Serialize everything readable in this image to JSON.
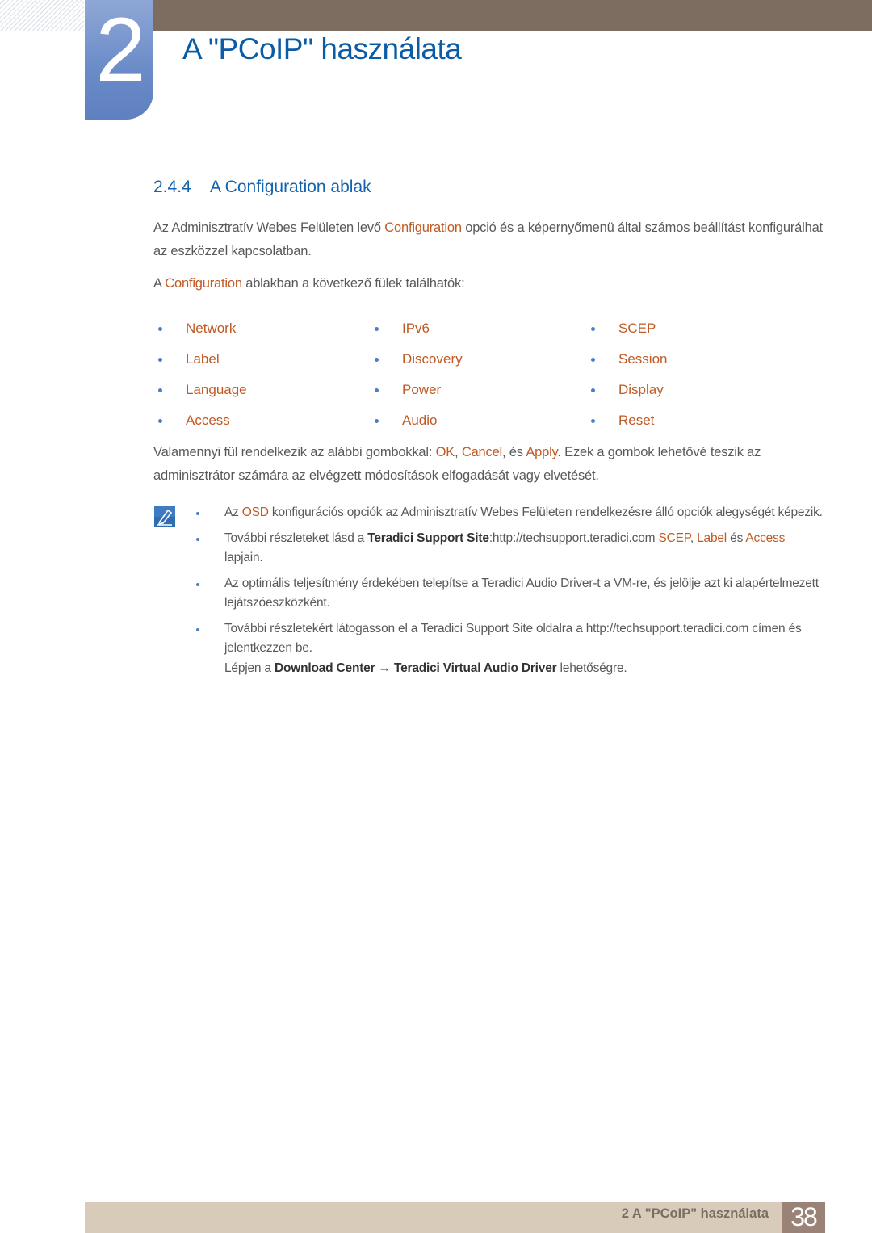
{
  "header": {
    "chapter_number": "2",
    "chapter_title": "A \"PCoIP\" használata"
  },
  "section": {
    "number": "2.4.4",
    "title": "A Configuration ablak"
  },
  "intro": {
    "p1_a": "Az Adminisztratív Webes Felületen levő ",
    "p1_hl": "Configuration",
    "p1_b": " opció és a képernyőmenü által számos beállítást konfigurálhat az eszközzel kapcsolatban.",
    "p2_a": "A ",
    "p2_hl": "Configuration",
    "p2_b": " ablakban a következő fülek találhatók:"
  },
  "tabs": [
    [
      "Network",
      "IPv6",
      "SCEP"
    ],
    [
      "Label",
      "Discovery",
      "Session"
    ],
    [
      "Language",
      "Power",
      "Display"
    ],
    [
      "Access",
      "Audio",
      "Reset"
    ]
  ],
  "buttons_para": {
    "a": "Valamennyi fül rendelkezik az alábbi gombokkal: ",
    "ok": "OK",
    "sep1": ", ",
    "cancel": "Cancel",
    "sep2": ", és ",
    "apply": "Apply",
    "b": ". Ezek a gombok lehetővé teszik az adminisztrátor számára az elvégzett módosítások elfogadását vagy elvetését."
  },
  "notes": {
    "icon": "note-pencil-icon",
    "n1_a": "Az ",
    "n1_hl": "OSD",
    "n1_b": " konfigurációs opciók az Adminisztratív Webes Felületen rendelkezésre álló opciók alegységét képezik.",
    "n2_a": "További részleteket lásd a ",
    "n2_bold": "Teradici Support Site",
    "n2_b": ":http://techsupport.teradici.com ",
    "n2_hl1": "SCEP",
    "n2_c": ", ",
    "n2_hl2": "Label",
    "n2_d": " és ",
    "n2_hl3": "Access",
    "n2_e": " lapjain.",
    "n3": "Az optimális teljesítmény érdekében telepítse a Teradici Audio Driver-t a VM-re, és jelölje azt ki alapértelmezett lejátszóeszközként.",
    "n4_a": "További részletekért látogasson el a Teradici Support Site oldalra a http://techsupport.teradici.com címen és jelentkezzen be.",
    "n4_b": "Lépjen a ",
    "n4_bold1": "Download Center",
    "n4_arrow": " → ",
    "n4_bold2": "Teradici Virtual Audio Driver",
    "n4_c": " lehetőségre."
  },
  "footer": {
    "text": "2 A \"PCoIP\" használata",
    "page": "38"
  },
  "colors": {
    "accent_blue": "#0b5ca5",
    "highlight_orange": "#c05a25",
    "topbar_brown": "#7c6d60",
    "footer_beige": "#d9cbb9",
    "page_box": "#9a8376"
  }
}
